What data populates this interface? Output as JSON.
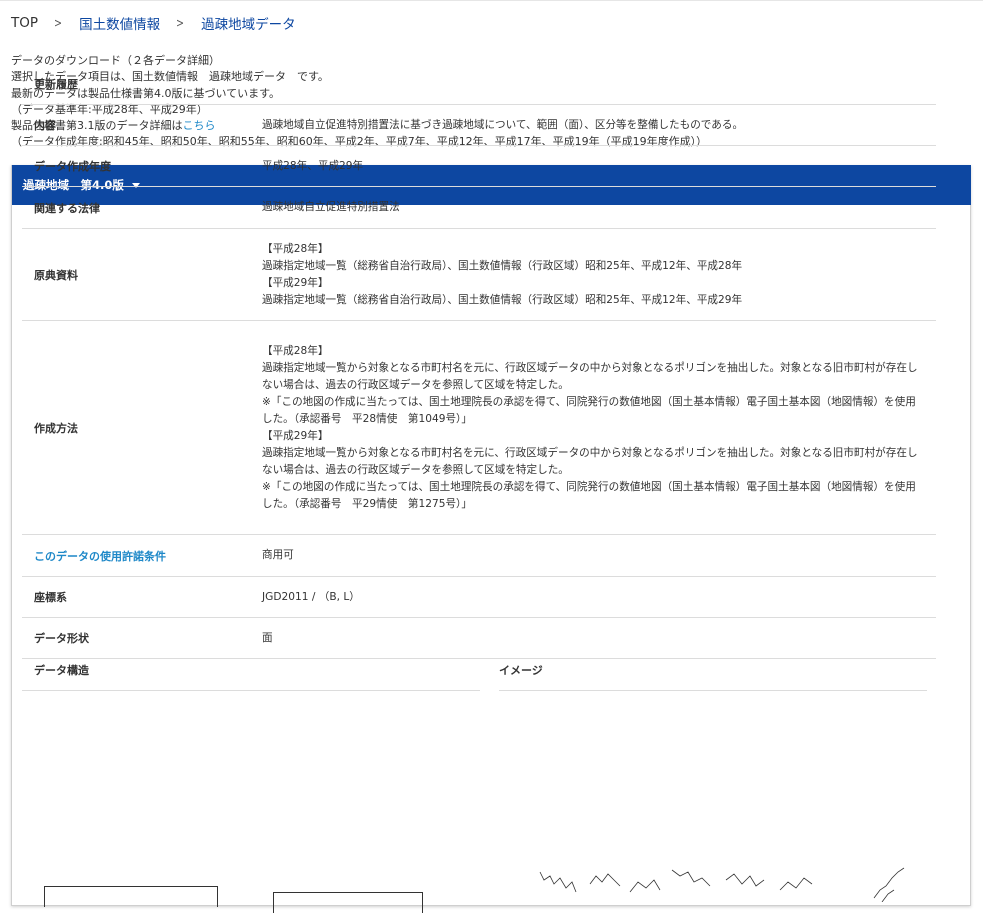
{
  "colors": {
    "header_bg": "#0d47a1",
    "link": "#1e88c8",
    "breadcrumb_link": "#0d47a1"
  },
  "breadcrumb": {
    "top": "TOP",
    "level1": "国土数値情報",
    "level2": "過疎地域データ"
  },
  "intro": {
    "line1": "データのダウンロード（２各データ詳細）",
    "line2": "選択したデータ項目は、国土数値情報　過疎地域データ　です。",
    "line3": "最新のデータは製品仕様書第4.0版に基づいています。",
    "line4": "（データ基準年:平成28年、平成29年）",
    "line5_prefix": "製品仕様書第3.1版のデータ詳細は",
    "line5_link": "こちら",
    "line6": "（データ作成年度:昭和45年、昭和50年、昭和55年、昭和60年、平成2年、平成7年、平成12年、平成17年、平成19年（平成19年度作成））"
  },
  "panel": {
    "title": "過疎地域　第4.0版"
  },
  "table": {
    "history_label": "更新履歴",
    "content_label": "内容",
    "content_value": "過疎地域自立促進特別措置法に基づき過疎地域について、範囲（面）、区分等を整備したものである。",
    "year_label": "データ作成年度",
    "year_value": "平成28年、平成29年",
    "law_label": "関連する法律",
    "law_value": "過疎地域自立促進特別措置法",
    "source_label": "原典資料",
    "source_value": "【平成28年】\n過疎指定地域一覧（総務省自治行政局）、国土数値情報（行政区域）昭和25年、平成12年、平成28年\n【平成29年】\n過疎指定地域一覧（総務省自治行政局）、国土数値情報（行政区域）昭和25年、平成12年、平成29年",
    "method_label": "作成方法",
    "method_value": "【平成28年】\n過疎指定地域一覧から対象となる市町村名を元に、行政区域データの中から対象となるポリゴンを抽出した。対象となる旧市町村が存在しない場合は、過去の行政区域データを参照して区域を特定した。\n※「この地図の作成に当たっては、国土地理院長の承認を得て、同院発行の数値地図（国土基本情報）電子国土基本図（地図情報）を使用した。（承認番号　平28情使　第1049号）」\n【平成29年】\n過疎指定地域一覧から対象となる市町村名を元に、行政区域データの中から対象となるポリゴンを抽出した。対象となる旧市町村が存在しない場合は、過去の行政区域データを参照して区域を特定した。\n※「この地図の作成に当たっては、国土地理院長の承認を得て、同院発行の数値地図（国土基本情報）電子国土基本図（地図情報）を使用した。（承認番号　平29情使　第1275号）」",
    "license_label": "このデータの使用許諾条件",
    "license_value": "商用可",
    "crs_label": "座標系",
    "crs_value": "JGD2011 / （B, L）",
    "shape_label": "データ形状",
    "shape_value": "面",
    "structure_label": "データ構造",
    "image_label": "イメージ"
  }
}
